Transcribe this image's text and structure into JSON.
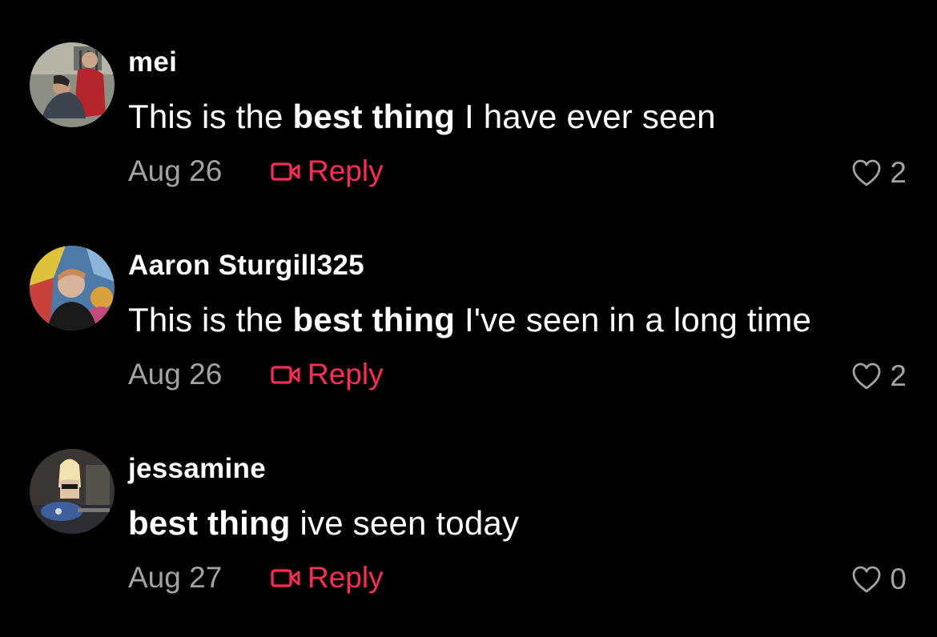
{
  "theme": {
    "background": "#000000",
    "text": "#ffffff",
    "muted": "#a3a3a3",
    "accent": "#fe2c55"
  },
  "comments": [
    {
      "avatar_icon": "avatar-photo-icon",
      "username": "mei",
      "text_pre": "This is the ",
      "text_bold": "best thing",
      "text_post": " I have ever seen",
      "date": "Aug 26",
      "reply_icon": "video-reply-icon",
      "reply_label": "Reply",
      "like_icon": "heart-outline-icon",
      "likes": "2"
    },
    {
      "avatar_icon": "avatar-photo-icon",
      "username": "Aaron Sturgill325",
      "text_pre": "This is the ",
      "text_bold": "best thing",
      "text_post": " I've seen in a long time",
      "date": "Aug 26",
      "reply_icon": "video-reply-icon",
      "reply_label": "Reply",
      "like_icon": "heart-outline-icon",
      "likes": "2"
    },
    {
      "avatar_icon": "avatar-photo-icon",
      "username": "jessamine",
      "text_pre": "",
      "text_bold": "best thing",
      "text_post": " ive seen today",
      "date": "Aug 27",
      "reply_icon": "video-reply-icon",
      "reply_label": "Reply",
      "like_icon": "heart-outline-icon",
      "likes": "0"
    }
  ]
}
